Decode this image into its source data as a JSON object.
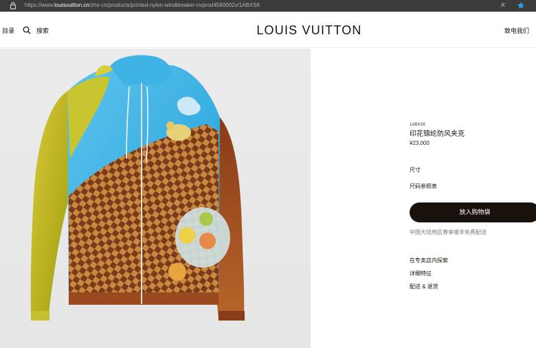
{
  "browser": {
    "url_prefix": "https://www.",
    "url_domain": "louisvuitton.cn",
    "url_path": "/zhs-cn/products/printed-nylon-windbreaker-nvprod4560002v/1ABXSK",
    "read_aloud_label": "Aʹ",
    "icons": [
      "lock-icon",
      "star-icon"
    ],
    "star_color": "#2f9be5"
  },
  "header": {
    "menu_label": "目录",
    "search_label": "搜索",
    "logo": "LOUIS VUITTON",
    "contact_label": "致电我们",
    "icons": [
      "search-icon"
    ]
  },
  "product": {
    "sku": "1ABXSK",
    "name": "印花锦纶防风夹克",
    "price": "¥23,000",
    "size_label": "尺寸",
    "size_guide": "尺码参照表",
    "add_to_cart": "放入购物袋",
    "shipping_note": "中国大陆地区尊享顺丰免费配送",
    "links": [
      "在专卖店内探索",
      "详细特征",
      "配送 & 退货"
    ]
  },
  "colors": {
    "brand_dark": "#19110b",
    "address_bar": "#3b3b3b",
    "image_bg": "#ebebeb"
  }
}
